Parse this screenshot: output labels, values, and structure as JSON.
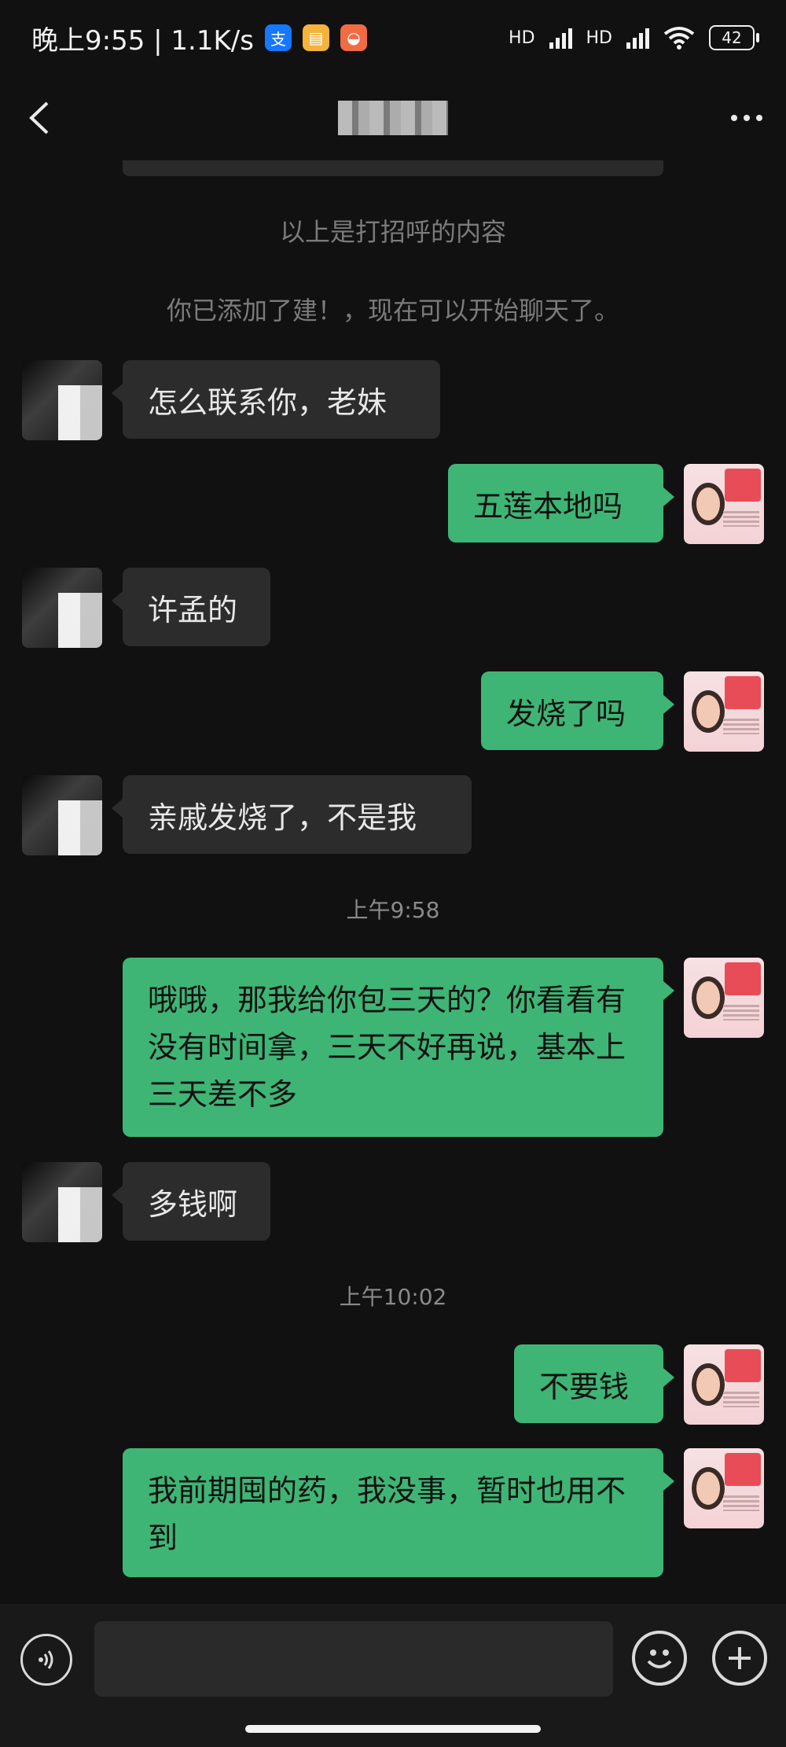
{
  "status_bar": {
    "time_text": "晚上9:55 | 1.1K/s",
    "net_1": "HD",
    "net_2": "HD",
    "battery": "42",
    "app_icons": [
      "alipay-icon",
      "notes-icon",
      "shop-icon"
    ]
  },
  "nav": {
    "back_icon": "chevron-left-icon",
    "more_icon": "more-dots-icon"
  },
  "chat": {
    "system_messages": [
      "以上是打招呼的内容",
      "你已添加了建！，现在可以开始聊天了。"
    ],
    "timestamps": [
      "上午9:58",
      "上午10:02"
    ],
    "messages": [
      {
        "side": "in",
        "text": "怎么联系你，老妹"
      },
      {
        "side": "out",
        "text": "五莲本地吗"
      },
      {
        "side": "in",
        "text": "许孟的"
      },
      {
        "side": "out",
        "text": "发烧了吗"
      },
      {
        "side": "in",
        "text": "亲戚发烧了，不是我"
      },
      {
        "side": "out",
        "text": "哦哦，那我给你包三天的？你看看有没有时间拿，三天不好再说，基本上三天差不多"
      },
      {
        "side": "in",
        "text": "多钱啊"
      },
      {
        "side": "out",
        "text": "不要钱"
      },
      {
        "side": "out",
        "text": "我前期囤的药，我没事，暂时也用不到"
      }
    ]
  },
  "input_bar": {
    "voice_icon": "voice-icon",
    "emoji_icon": "emoji-icon",
    "plus_icon": "plus-icon"
  },
  "colors": {
    "background": "#111111",
    "incoming_bubble": "#2c2c2c",
    "outgoing_bubble": "#3eb575",
    "system_text": "#7b7b7b"
  }
}
